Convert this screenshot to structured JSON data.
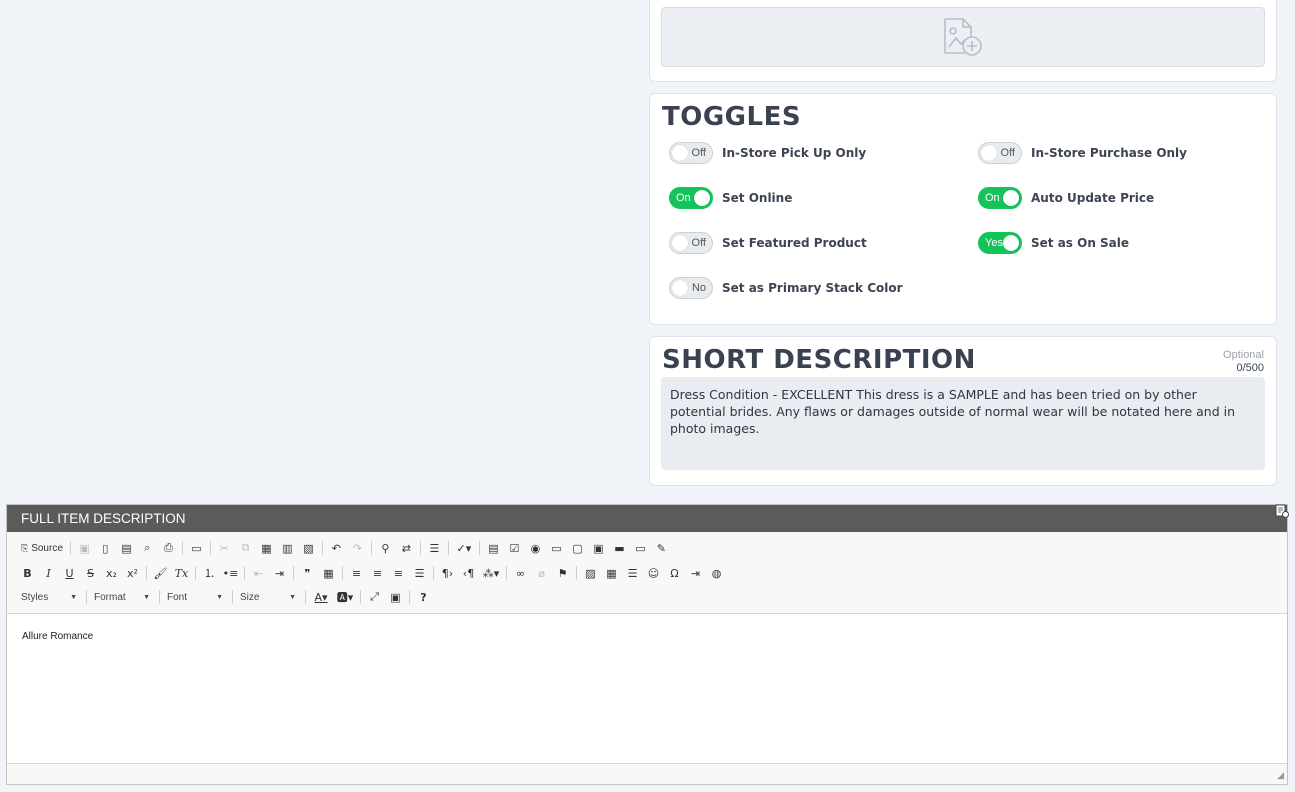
{
  "toggles": {
    "title": "TOGGLES",
    "items": [
      {
        "label": "In-Store Pick Up Only",
        "state": "Off",
        "on": false
      },
      {
        "label": "In-Store Purchase Only",
        "state": "Off",
        "on": false
      },
      {
        "label": "Set Online",
        "state": "On",
        "on": true
      },
      {
        "label": "Auto Update Price",
        "state": "On",
        "on": true
      },
      {
        "label": "Set Featured Product",
        "state": "Off",
        "on": false
      },
      {
        "label": "Set as On Sale",
        "state": "Yes",
        "on": true
      },
      {
        "label": "Set as Primary Stack Color",
        "state": "No",
        "on": false
      }
    ]
  },
  "short_description": {
    "title": "SHORT DESCRIPTION",
    "optional": "Optional",
    "count": "0/500",
    "text": "Dress Condition - EXCELLENT  This dress is a SAMPLE and has been tried on by other potential brides. Any flaws or damages outside of normal wear will be notated here and in photo images."
  },
  "full_description": {
    "title": "FULL ITEM DESCRIPTION",
    "source_label": "Source",
    "styles_label": "Styles",
    "format_label": "Format",
    "font_label": "Font",
    "size_label": "Size",
    "content": "Allure Romance"
  },
  "colors": {
    "toggle_on": "#14c45a",
    "editor_header": "#5b5b5b",
    "page_bg": "#f0f3f7"
  }
}
